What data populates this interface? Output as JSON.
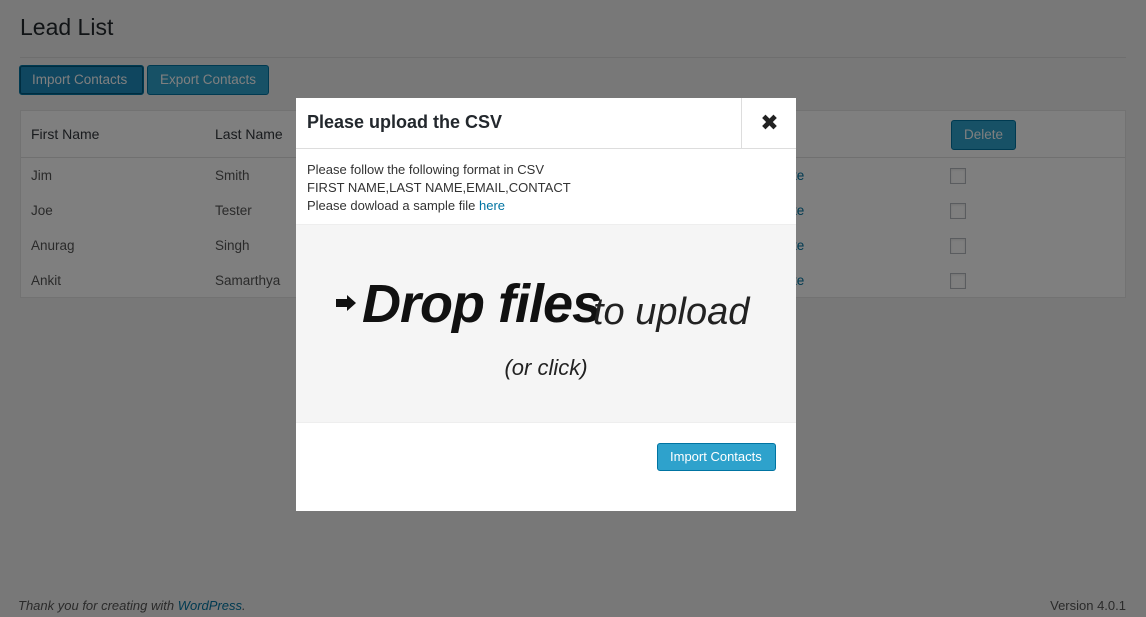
{
  "page": {
    "title": "Lead List",
    "import_label": "Import Contacts",
    "export_label": "Export Contacts"
  },
  "table": {
    "headers": [
      "First Name",
      "Last Name"
    ],
    "delete_label": "Delete",
    "action_link_fragment": "te",
    "rows": [
      {
        "first": "Jim",
        "last": "Smith"
      },
      {
        "first": "Joe",
        "last": "Tester"
      },
      {
        "first": "Anurag",
        "last": "Singh"
      },
      {
        "first": "Ankit",
        "last": "Samarthya"
      }
    ]
  },
  "modal": {
    "title": "Please upload the CSV",
    "close_glyph": "✖",
    "instr_line1": "Please follow the following format in CSV",
    "instr_line2": "FIRST NAME,LAST NAME,EMAIL,CONTACT",
    "instr_line3": "Please dowload a sample file",
    "instr_link": "here",
    "drop_main": "Drop files",
    "drop_sub": "to upload",
    "drop_click": "(or click)",
    "import_label": "Import Contacts",
    "arrow_icon": "arrow-right-icon"
  },
  "footer": {
    "thanks": "Thank you for creating with",
    "link": "WordPress",
    "link_suffix": ".",
    "version": "Version 4.0.1"
  },
  "colors": {
    "primary": "#2ea2cc",
    "link": "#0074a2",
    "overlay": "rgba(0,0,0,0.5)"
  }
}
